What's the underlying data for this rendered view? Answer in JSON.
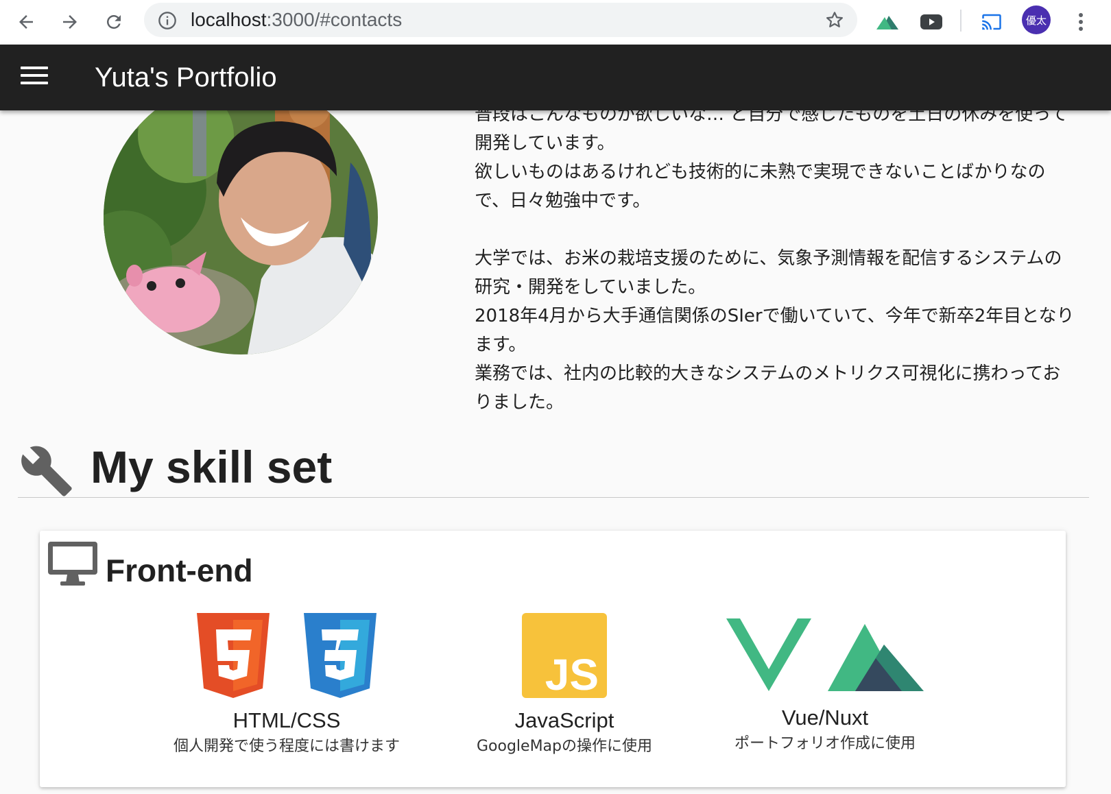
{
  "browser": {
    "url_host": "localhost",
    "url_path": ":3000/#contacts",
    "profile_initials": "優太"
  },
  "appbar": {
    "title": "Yuta's Portfolio"
  },
  "about": {
    "paragraphs": [
      "普段はこんなものが欲しいな… と自分で感じたものを土日の休みを使って開発しています。",
      "欲しいものはあるけれども技術的に未熟で実現できないことばかりなので、日々勉強中です。",
      "大学では、お米の栽培支援のために、気象予測情報を配信するシステムの研究・開発をしていました。",
      "2018年4月から大手通信関係のSIerで働いていて、今年で新卒2年目となります。",
      "業務では、社内の比較的大きなシステムのメトリクス可視化に携わっておりました。"
    ]
  },
  "skills": {
    "heading": "My skill set",
    "frontend": {
      "title": "Front-end",
      "items": [
        {
          "name": "HTML/CSS",
          "desc": "個人開発で使う程度には書けます"
        },
        {
          "name": "JavaScript",
          "desc": "GoogleMapの操作に使用"
        },
        {
          "name": "Vue/Nuxt",
          "desc": "ポートフォリオ作成に使用"
        }
      ]
    }
  },
  "colors": {
    "appbar": "#212121",
    "html5": "#e44d26",
    "css3": "#2a7fcc",
    "js": "#f7c23b",
    "vue_green": "#41b883",
    "vue_dark": "#35495e"
  }
}
